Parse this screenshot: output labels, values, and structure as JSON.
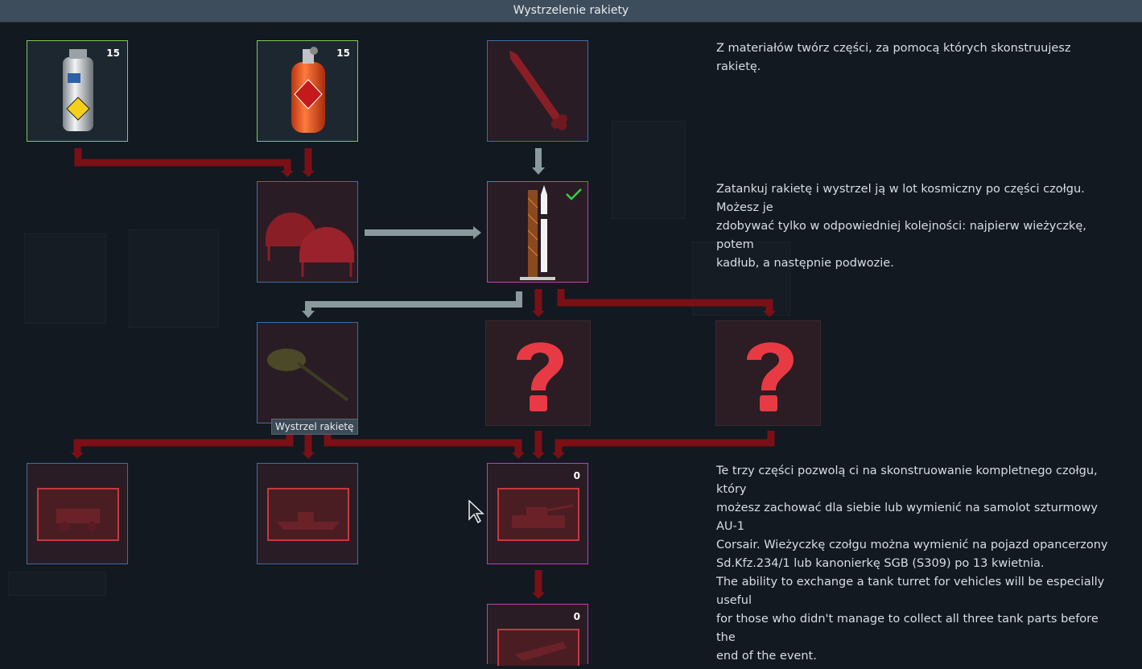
{
  "window": {
    "title": "Wystrzelenie rakiety"
  },
  "tiles": {
    "hydrogen_tank": {
      "count": "15",
      "icon": "hydrogen-tank-icon"
    },
    "oxygen_tank": {
      "count": "15",
      "icon": "oxygen-tank-icon"
    },
    "rocket_blueprint": {
      "icon": "rocket-icon"
    },
    "fuel_storage": {
      "icon": "fuel-storage-icon"
    },
    "launch_pad": {
      "icon": "launch-pad-icon",
      "status": "completed"
    },
    "tank_turret": {
      "icon": "tank-turret-icon"
    },
    "unknown_hull": {
      "icon": "question-mark-icon"
    },
    "unknown_chassis": {
      "icon": "question-mark-icon"
    },
    "armored_car": {
      "icon": "armored-car-icon"
    },
    "gunboat": {
      "icon": "gunboat-icon"
    },
    "full_tank": {
      "count": "0",
      "icon": "tank-icon"
    },
    "aircraft": {
      "count": "0",
      "icon": "aircraft-icon"
    }
  },
  "tooltip": {
    "text": "Wystrzel rakietę"
  },
  "descriptions": {
    "first": "Z materiałów twórz części, za pomocą których skonstruujesz rakietę.",
    "second": [
      "Zatankuj rakietę i wystrzel ją w lot kosmiczny po części czołgu. Możesz je",
      "zdobywać tylko w odpowiedniej kolejności: najpierw wieżyczkę, potem",
      "kadłub, a następnie podwozie."
    ],
    "third": [
      "Te trzy części pozwolą ci na skonstruowanie kompletnego czołgu, który",
      "możesz zachować dla siebie lub wymienić na samolot szturmowy AU-1",
      "Corsair. Wieżyczkę czołgu można wymienić na pojazd opancerzony",
      "Sd.Kfz.234/1 lub kanonierkę SGB (S309) po 13 kwietnia.",
      "The ability to exchange a tank turret for vehicles will be especially useful",
      "for those who didn't manage to collect all three tank parts before the",
      "end of the event."
    ]
  },
  "colors": {
    "accent_green": "#7fc85a",
    "accent_blue": "#3f6da6",
    "accent_pink": "#c03fb8",
    "connector_red": "#7a1016",
    "connector_grey": "#8a9a9c"
  }
}
